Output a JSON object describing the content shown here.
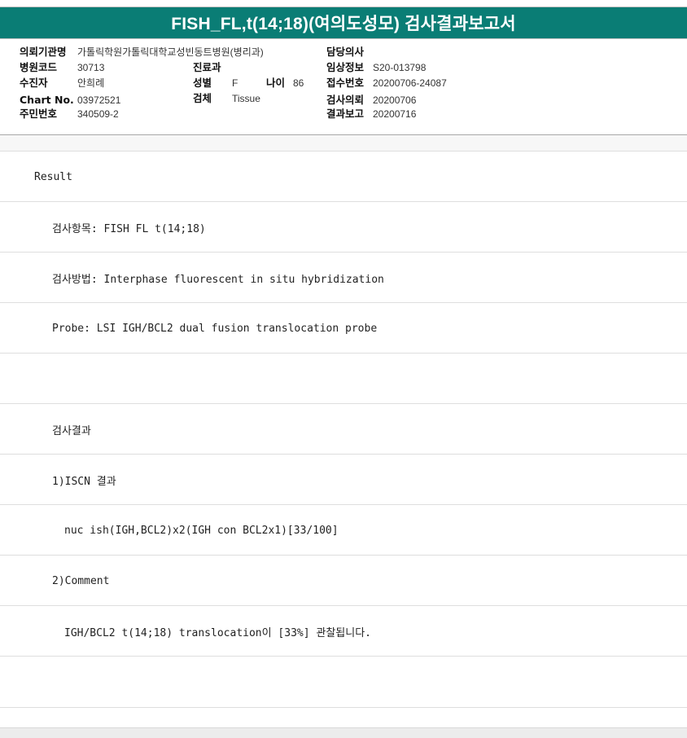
{
  "report": {
    "title": "FISH_FL,t(14;18)(여의도성모) 검사결과보고서"
  },
  "info": {
    "requesting_institution": {
      "label": "의뢰기관명",
      "value": "가톨릭학원가톨릭대학교성빈동트병원(병리과)"
    },
    "hospital_code": {
      "label": "병원코드",
      "value": "30713"
    },
    "patient": {
      "label": "수진자",
      "value": "안희례"
    },
    "chart_no": {
      "label": "Chart No.",
      "value": "03972521"
    },
    "resident_no": {
      "label": "주민번호",
      "value": "340509-2"
    },
    "department": {
      "label": "진료과",
      "value": ""
    },
    "sex": {
      "label": "성별",
      "value": "F"
    },
    "age": {
      "label": "나이",
      "value": "86"
    },
    "specimen": {
      "label": "검체",
      "value": "Tissue"
    },
    "physician": {
      "label": "담당의사",
      "value": ""
    },
    "clinical_info": {
      "label": "임상정보",
      "value": "S20-013798"
    },
    "receipt_no": {
      "label": "접수번호",
      "value": "20200706-24087"
    },
    "test_request": {
      "label": "검사의뢰",
      "value": "20200706"
    },
    "result_report": {
      "label": "결과보고",
      "value": "20200716"
    }
  },
  "result": {
    "lines": [
      "Result",
      "검사항목: FISH FL t(14;18)",
      "검사방법: Interphase fluorescent in situ hybridization",
      "Probe: LSI IGH/BCL2 dual fusion translocation probe",
      "",
      "검사결과",
      "1)ISCN 결과",
      "nuc ish(IGH,BCL2)x2(IGH con BCL2x1)[33/100]",
      "2)Comment",
      "IGH/BCL2 t(14;18) translocation이 [33%] 관찰됩니다.",
      ""
    ]
  }
}
